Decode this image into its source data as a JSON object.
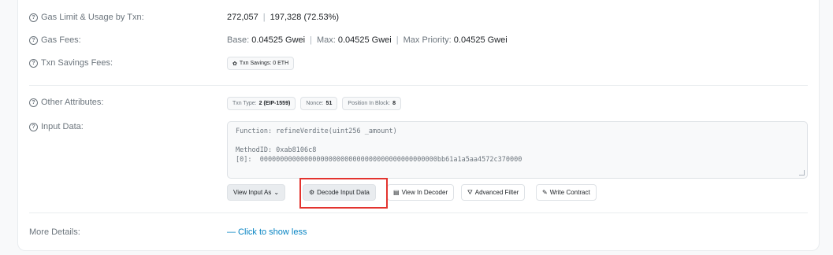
{
  "gas_limit": {
    "label": "Gas Limit & Usage by Txn:",
    "limit": "272,057",
    "usage": "197,328 (72.53%)"
  },
  "gas_fees": {
    "label": "Gas Fees:",
    "base_key": "Base:",
    "base_val": "0.04525 Gwei",
    "max_key": "Max:",
    "max_val": "0.04525 Gwei",
    "priority_key": "Max Priority:",
    "priority_val": "0.04525 Gwei"
  },
  "savings": {
    "label": "Txn Savings Fees:",
    "badge": "Txn Savings: 0 ETH"
  },
  "attributes": {
    "label": "Other Attributes:",
    "txn_type_key": "Txn Type:",
    "txn_type_val": "2 (EIP-1559)",
    "nonce_key": "Nonce:",
    "nonce_val": "51",
    "position_key": "Position In Block:",
    "position_val": "8"
  },
  "input_data": {
    "label": "Input Data:",
    "function_line": "Function: refineVerdite(uint256 _amount)",
    "method_line": "MethodID: 0xab8106c8",
    "param_line": "[0]:  00000000000000000000000000000000000000000000bb61a1a5aa4572c370000"
  },
  "buttons": {
    "view_input_as": "View Input As",
    "decode": "Decode Input Data",
    "view_decoder": "View In Decoder",
    "advanced_filter": "Advanced Filter",
    "write_contract": "Write Contract"
  },
  "more_details": {
    "label": "More Details:",
    "link": "— Click to show less"
  },
  "colors": {
    "highlight": "#e3342f",
    "link": "#0784c3"
  }
}
